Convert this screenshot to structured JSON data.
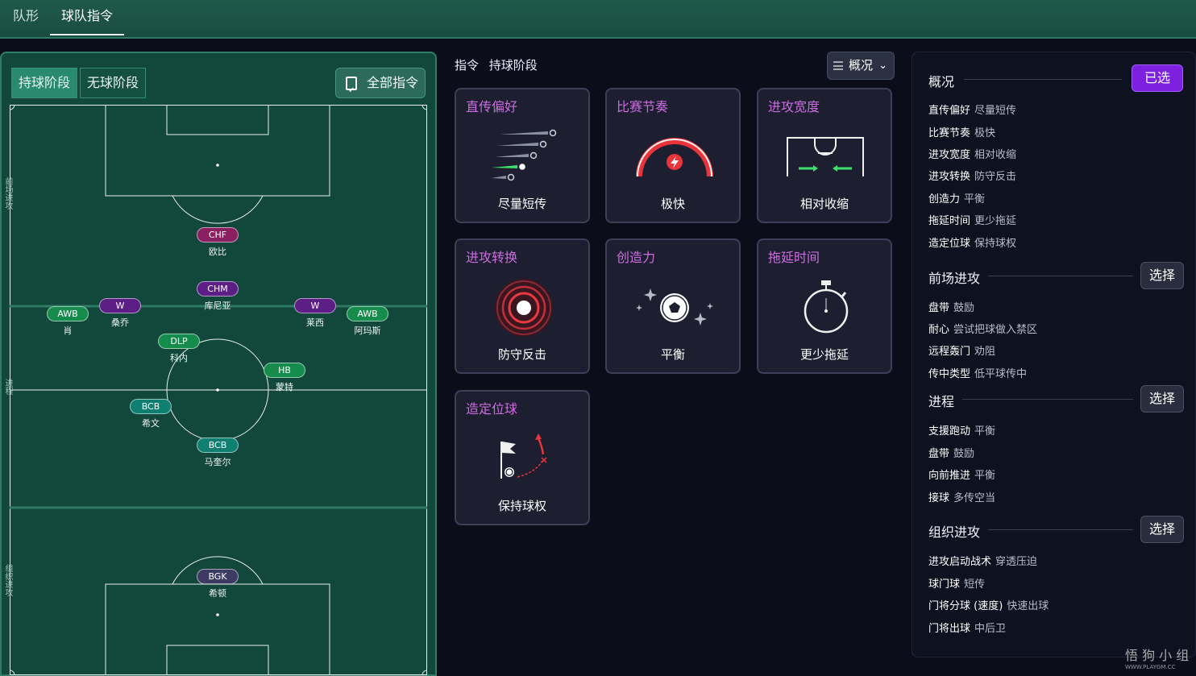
{
  "tabs": [
    "队形",
    "球队指令"
  ],
  "pitch": {
    "phase_tabs": [
      "持球阶段",
      "无球阶段"
    ],
    "all_instructions": "全部指令",
    "zone_labels": [
      "前场进攻",
      "进程",
      "组织进攻"
    ],
    "players": [
      {
        "role": "CHF",
        "name": "欧比",
        "type": "attack"
      },
      {
        "role": "CHM",
        "name": "库尼亚",
        "type": "mid"
      },
      {
        "role": "W",
        "name": "桑乔",
        "type": "mid"
      },
      {
        "role": "W",
        "name": "莱西",
        "type": "mid"
      },
      {
        "role": "AWB",
        "name": "肖",
        "type": "wide"
      },
      {
        "role": "AWB",
        "name": "阿玛斯",
        "type": "wide"
      },
      {
        "role": "DLP",
        "name": "科内",
        "type": "wide"
      },
      {
        "role": "HB",
        "name": "蒙特",
        "type": "wide"
      },
      {
        "role": "BCB",
        "name": "希文",
        "type": "def"
      },
      {
        "role": "BCB",
        "name": "马奎尔",
        "type": "def"
      },
      {
        "role": "BGK",
        "name": "希顿",
        "type": "gk"
      }
    ]
  },
  "instructions": {
    "label": "指令",
    "phase": "持球阶段",
    "view": "概况",
    "cards": [
      {
        "title": "直传偏好",
        "value": "尽量短传",
        "icon": "short-pass-icon"
      },
      {
        "title": "比赛节奏",
        "value": "极快",
        "icon": "tempo-gauge-icon"
      },
      {
        "title": "进攻宽度",
        "value": "相对收缩",
        "icon": "attack-width-icon"
      },
      {
        "title": "进攻转换",
        "value": "防守反击",
        "icon": "transition-target-icon"
      },
      {
        "title": "创造力",
        "value": "平衡",
        "icon": "creativity-ball-icon"
      },
      {
        "title": "拖延时间",
        "value": "更少拖延",
        "icon": "stopwatch-icon"
      },
      {
        "title": "造定位球",
        "value": "保持球权",
        "icon": "set-piece-flag-icon"
      }
    ]
  },
  "summary": {
    "sections": [
      {
        "title": "概况",
        "button": "已选",
        "rows": [
          {
            "k": "直传偏好",
            "v": "尽量短传"
          },
          {
            "k": "比赛节奏",
            "v": "极快"
          },
          {
            "k": "进攻宽度",
            "v": "相对收缩"
          },
          {
            "k": "进攻转换",
            "v": "防守反击"
          },
          {
            "k": "创造力",
            "v": "平衡"
          },
          {
            "k": "拖延时间",
            "v": "更少拖延"
          },
          {
            "k": "造定位球",
            "v": "保持球权"
          }
        ]
      },
      {
        "title": "前场进攻",
        "button": "选择",
        "rows": [
          {
            "k": "盘带",
            "v": "鼓励"
          },
          {
            "k": "耐心",
            "v": "尝试把球做入禁区"
          },
          {
            "k": "远程轰门",
            "v": "劝阻"
          },
          {
            "k": "传中类型",
            "v": "低平球传中"
          }
        ]
      },
      {
        "title": "进程",
        "button": "选择",
        "rows": [
          {
            "k": "支援跑动",
            "v": "平衡"
          },
          {
            "k": "盘带",
            "v": "鼓励"
          },
          {
            "k": "向前推进",
            "v": "平衡"
          },
          {
            "k": "接球",
            "v": "多传空当"
          }
        ]
      },
      {
        "title": "组织进攻",
        "button": "选择",
        "rows": [
          {
            "k": "进攻启动战术",
            "v": "穿透压迫"
          },
          {
            "k": "球门球",
            "v": "短传"
          },
          {
            "k": "门将分球 (速度)",
            "v": "快速出球"
          },
          {
            "k": "门将出球",
            "v": "中后卫"
          }
        ]
      }
    ]
  },
  "watermark": {
    "main": "悟 狗 小 组",
    "sub": "WWW.PLAYGM.CC"
  },
  "colors": {
    "accent_purple": "#cc6ce0",
    "selected": "#7d20e0",
    "pitch": "#12473b"
  }
}
